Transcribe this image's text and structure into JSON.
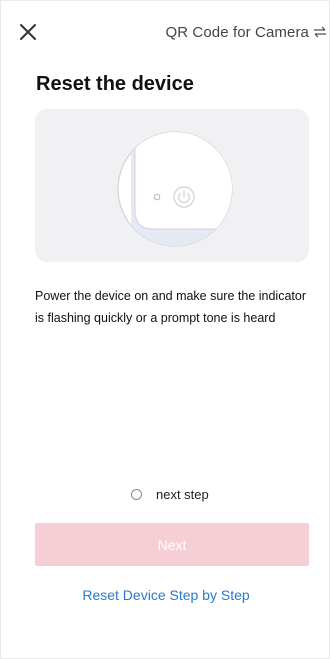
{
  "header": {
    "close_icon": "close-icon",
    "mode_label": "QR Code for Camera",
    "switch_icon": "swap-icon"
  },
  "page": {
    "title": "Reset the device",
    "instruction": "Power the device on and make sure the indicator is flashing quickly or a prompt tone is heard"
  },
  "illustration": {
    "icon": "power-button-illustration"
  },
  "confirm": {
    "label": "next step",
    "checked": false
  },
  "actions": {
    "next_label": "Next",
    "next_enabled": false,
    "help_link": "Reset Device Step by Step"
  },
  "colors": {
    "next_button_disabled": "#f5cfd5",
    "link": "#2c79c8",
    "illustration_bg": "#f1f1f3"
  }
}
